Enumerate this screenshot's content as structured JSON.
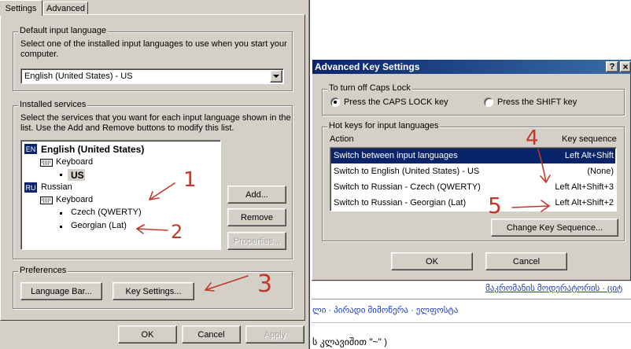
{
  "settings": {
    "tabs": [
      {
        "label": "Settings",
        "active": true
      },
      {
        "label": "Advanced",
        "active": false
      }
    ],
    "default_input": {
      "title": "Default input language",
      "desc": "Select one of the installed input languages to use when you start your computer.",
      "selected": "English (United States) - US"
    },
    "installed": {
      "title": "Installed services",
      "desc": "Select the services that you want for each input language shown in the list. Use the Add and Remove buttons to modify this list.",
      "tree": {
        "en_badge": "EN",
        "en_label": "English (United States)",
        "en_keyboard": "Keyboard",
        "en_us": "US",
        "ru_badge": "RU",
        "ru_label": "Russian",
        "ru_keyboard": "Keyboard",
        "ru_czech": "Czech (QWERTY)",
        "ru_georgian": "Georgian (Lat)"
      },
      "add": "Add...",
      "remove": "Remove",
      "properties": "Properties..."
    },
    "preferences": {
      "title": "Preferences",
      "language_bar": "Language Bar...",
      "key_settings": "Key Settings..."
    },
    "footer": {
      "ok": "OK",
      "cancel": "Cancel",
      "apply": "Apply"
    }
  },
  "adv": {
    "title": "Advanced Key Settings",
    "help": "?",
    "close": "×",
    "caps": {
      "title": "To turn off Caps Lock",
      "opt1": "Press the CAPS LOCK key",
      "opt2": "Press the SHIFT key",
      "selected": 1
    },
    "hotkeys": {
      "title": "Hot keys for input languages",
      "col_action": "Action",
      "col_key": "Key sequence",
      "rows": [
        {
          "action": "Switch between input languages",
          "key": "Left Alt+Shift",
          "selected": true
        },
        {
          "action": "Switch to English (United States) - US",
          "key": "(None)"
        },
        {
          "action": "Switch to Russian - Czech (QWERTY)",
          "key": "Left Alt+Shift+3"
        },
        {
          "action": "Switch to Russian - Georgian (Lat)",
          "key": "Left Alt+Shift+2"
        }
      ],
      "change": "Change Key Sequence..."
    },
    "ok": "OK",
    "cancel": "Cancel"
  },
  "background": {
    "line1": "მაკრომანის მოდერატორის · ციტ",
    "line2": "ლი · პირადი მიმოწერა · ელფოსტა",
    "line3": "ს კლავიშით \"~\" )"
  },
  "annotations": [
    "1",
    "2",
    "3",
    "4",
    "5"
  ],
  "colors": {
    "dialog_bg": "#d4d0c8",
    "titlebar": "#0a246a",
    "selection": "#0a246a",
    "annotation": "#c0392b",
    "link": "#1a3cc0"
  }
}
